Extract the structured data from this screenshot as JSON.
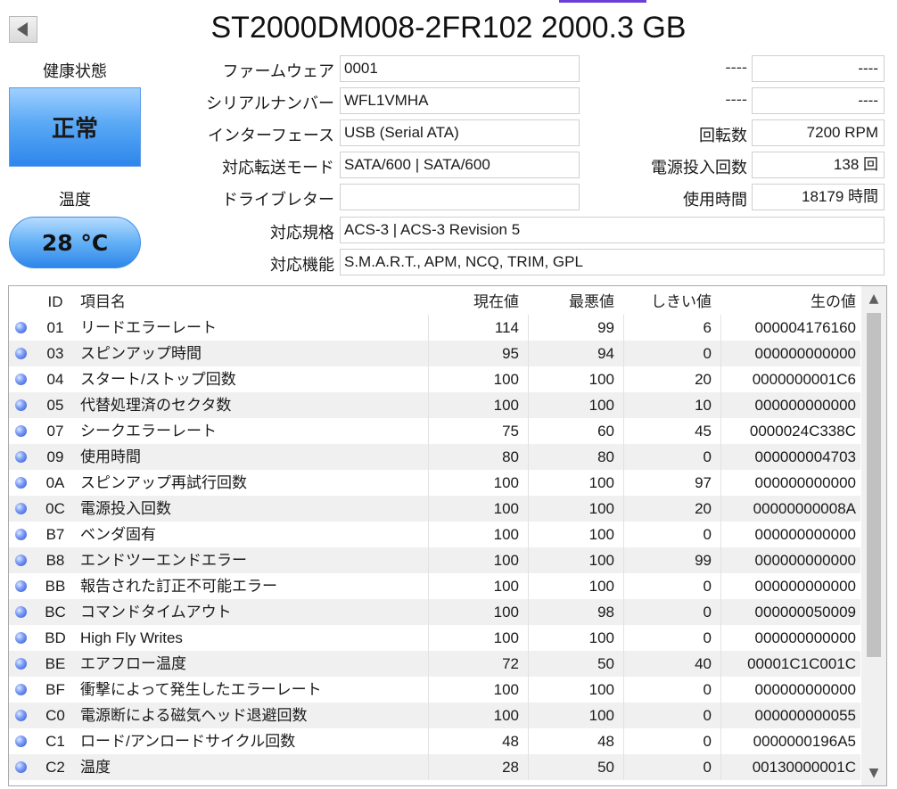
{
  "title": "ST2000DM008-2FR102 2000.3 GB",
  "health": {
    "label": "健康状態",
    "status": "正常"
  },
  "temperature": {
    "label": "温度",
    "value": "28 °C"
  },
  "info_left": [
    {
      "label": "ファームウェア",
      "value": "0001"
    },
    {
      "label": "シリアルナンバー",
      "value": "WFL1VMHA"
    },
    {
      "label": "インターフェース",
      "value": "USB (Serial ATA)"
    },
    {
      "label": "対応転送モード",
      "value": "SATA/600 | SATA/600"
    },
    {
      "label": "ドライブレター",
      "value": ""
    }
  ],
  "info_right": [
    {
      "label": "----",
      "value": "----"
    },
    {
      "label": "----",
      "value": "----"
    },
    {
      "label": "回転数",
      "value": "7200 RPM"
    },
    {
      "label": "電源投入回数",
      "value": "138 回"
    },
    {
      "label": "使用時間",
      "value": "18179 時間"
    }
  ],
  "standard": {
    "label": "対応規格",
    "value": "ACS-3 | ACS-3 Revision 5"
  },
  "features": {
    "label": "対応機能",
    "value": "S.M.A.R.T., APM, NCQ, TRIM, GPL"
  },
  "columns": {
    "id": "ID",
    "name": "項目名",
    "current": "現在値",
    "worst": "最悪値",
    "threshold": "しきい値",
    "raw": "生の値"
  },
  "rows": [
    {
      "id": "01",
      "name": "リードエラーレート",
      "current": "114",
      "worst": "99",
      "threshold": "6",
      "raw": "000004176160"
    },
    {
      "id": "03",
      "name": "スピンアップ時間",
      "current": "95",
      "worst": "94",
      "threshold": "0",
      "raw": "000000000000"
    },
    {
      "id": "04",
      "name": "スタート/ストップ回数",
      "current": "100",
      "worst": "100",
      "threshold": "20",
      "raw": "0000000001C6"
    },
    {
      "id": "05",
      "name": "代替処理済のセクタ数",
      "current": "100",
      "worst": "100",
      "threshold": "10",
      "raw": "000000000000"
    },
    {
      "id": "07",
      "name": "シークエラーレート",
      "current": "75",
      "worst": "60",
      "threshold": "45",
      "raw": "0000024C338C"
    },
    {
      "id": "09",
      "name": "使用時間",
      "current": "80",
      "worst": "80",
      "threshold": "0",
      "raw": "000000004703"
    },
    {
      "id": "0A",
      "name": "スピンアップ再試行回数",
      "current": "100",
      "worst": "100",
      "threshold": "97",
      "raw": "000000000000"
    },
    {
      "id": "0C",
      "name": "電源投入回数",
      "current": "100",
      "worst": "100",
      "threshold": "20",
      "raw": "00000000008A"
    },
    {
      "id": "B7",
      "name": "ベンダ固有",
      "current": "100",
      "worst": "100",
      "threshold": "0",
      "raw": "000000000000"
    },
    {
      "id": "B8",
      "name": "エンドツーエンドエラー",
      "current": "100",
      "worst": "100",
      "threshold": "99",
      "raw": "000000000000"
    },
    {
      "id": "BB",
      "name": "報告された訂正不可能エラー",
      "current": "100",
      "worst": "100",
      "threshold": "0",
      "raw": "000000000000"
    },
    {
      "id": "BC",
      "name": "コマンドタイムアウト",
      "current": "100",
      "worst": "98",
      "threshold": "0",
      "raw": "000000050009"
    },
    {
      "id": "BD",
      "name": "High Fly Writes",
      "current": "100",
      "worst": "100",
      "threshold": "0",
      "raw": "000000000000"
    },
    {
      "id": "BE",
      "name": "エアフロー温度",
      "current": "72",
      "worst": "50",
      "threshold": "40",
      "raw": "00001C1C001C"
    },
    {
      "id": "BF",
      "name": "衝撃によって発生したエラーレート",
      "current": "100",
      "worst": "100",
      "threshold": "0",
      "raw": "000000000000"
    },
    {
      "id": "C0",
      "name": "電源断による磁気ヘッド退避回数",
      "current": "100",
      "worst": "100",
      "threshold": "0",
      "raw": "000000000055"
    },
    {
      "id": "C1",
      "name": "ロード/アンロードサイクル回数",
      "current": "48",
      "worst": "48",
      "threshold": "0",
      "raw": "0000000196A5"
    },
    {
      "id": "C2",
      "name": "温度",
      "current": "28",
      "worst": "50",
      "threshold": "0",
      "raw": "00130000001C"
    }
  ],
  "scroll_up_icon": "▲",
  "scroll_down_icon": "▼"
}
